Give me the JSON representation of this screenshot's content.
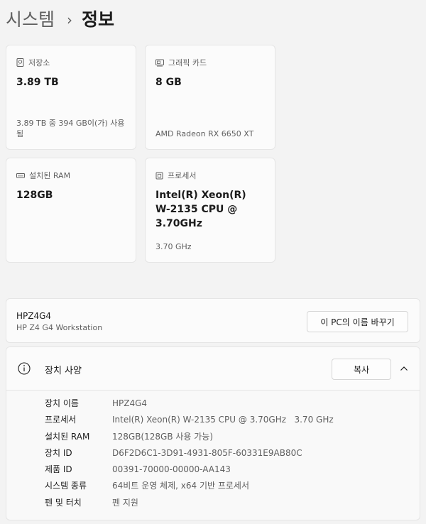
{
  "breadcrumb": {
    "parent": "시스템",
    "separator": "›",
    "current": "정보"
  },
  "cards": {
    "storage": {
      "icon": "storage-icon",
      "label": "저장소",
      "value": "3.89 TB",
      "sub": "3.89 TB 중 394 GB이(가) 사용됨"
    },
    "gpu": {
      "icon": "graphics-card-icon",
      "label": "그래픽 카드",
      "value": "8 GB",
      "sub": "AMD Radeon RX 6650 XT"
    },
    "ram": {
      "icon": "memory-icon",
      "label": "설치된 RAM",
      "value": "128GB",
      "sub": ""
    },
    "cpu": {
      "icon": "processor-icon",
      "label": "프로세서",
      "value": "Intel(R) Xeon(R) W-2135 CPU @ 3.70GHz",
      "sub": "3.70 GHz"
    }
  },
  "device": {
    "name": "HPZ4G4",
    "model": "HP Z4 G4 Workstation",
    "rename_label": "이 PC의 이름 바꾸기"
  },
  "specs": {
    "icon": "info-icon",
    "title": "장치 사양",
    "copy_label": "복사",
    "collapse_icon": "chevron-up-icon",
    "rows": [
      {
        "label": "장치 이름",
        "value": "HPZ4G4"
      },
      {
        "label": "프로세서",
        "value": "Intel(R) Xeon(R) W-2135 CPU @ 3.70GHz   3.70 GHz"
      },
      {
        "label": "설치된 RAM",
        "value": "128GB(128GB 사용 가능)"
      },
      {
        "label": "장치 ID",
        "value": "D6F2D6C1-3D91-4931-805F-60331E9AB80C"
      },
      {
        "label": "제품 ID",
        "value": "00391-70000-00000-AA143"
      },
      {
        "label": "시스템 종류",
        "value": "64비트 운영 체제, x64 기반 프로세서"
      },
      {
        "label": "펜 및 터치",
        "value": "펜 지원"
      }
    ]
  }
}
